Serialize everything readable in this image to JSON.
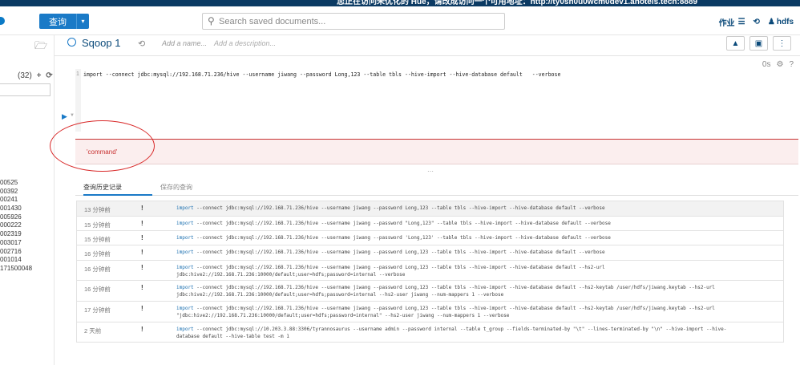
{
  "banner": {
    "text": "您正在访问未优化的 Hue，请改成访问一个可用地址：http://ty0sh0u0wcm0dev1.anotels.tech:8889"
  },
  "toolbar": {
    "query_label": "查询",
    "caret": "▾"
  },
  "search": {
    "placeholder": "Search saved documents..."
  },
  "top_right": {
    "jobs_label": "作业",
    "user_label": "hdfs"
  },
  "sidebar": {
    "count_label": "(32)",
    "items": [
      "00525",
      "00392",
      "00241",
      "001430",
      "005926",
      "000222",
      "002319",
      "003017",
      "002716",
      "001014",
      "171500048"
    ]
  },
  "snippet": {
    "title": "Sqoop 1",
    "name_placeholder": "Add a name...",
    "description_placeholder": "Add a description...",
    "tools_zero": "0s",
    "line_number": "1",
    "code": "import --connect jdbc:mysql://192.168.71.236/hive --username jiwang --password Long,123 --table tbls --hive-import --hive-database default   --verbose",
    "error": "'command'"
  },
  "tabs": {
    "history": "查询历史记录",
    "saved": "保存的查询"
  },
  "history": [
    {
      "time": "13 分钟前",
      "status": "!",
      "kw": "import",
      "cmd": " --connect jdbc:mysql://192.168.71.236/hive --username jiwang --password Long,123 --table tbls --hive-import --hive-database default --verbose",
      "line2": ""
    },
    {
      "time": "15 分钟前",
      "status": "!",
      "kw": "import",
      "cmd": " --connect jdbc:mysql://192.168.71.236/hive --username jiwang --password \"Long,123\" --table tbls --hive-import --hive-database default --verbose",
      "line2": ""
    },
    {
      "time": "15 分钟前",
      "status": "!",
      "kw": "import",
      "cmd": " --connect jdbc:mysql://192.168.71.236/hive --username jiwang --password 'Long,123' --table tbls --hive-import --hive-database default --verbose",
      "line2": ""
    },
    {
      "time": "16 分钟前",
      "status": "!",
      "kw": "import",
      "cmd": " --connect jdbc:mysql://192.168.71.236/hive --username jiwang --password Long,123 --table tbls --hive-import --hive-database default --verbose",
      "line2": ""
    },
    {
      "time": "16 分钟前",
      "status": "!",
      "kw": "import",
      "cmd": " --connect jdbc:mysql://192.168.71.236/hive --username jiwang --password Long,123 --table tbls --hive-import --hive-database default --hs2-url",
      "line2": "jdbc:hive2://192.168.71.236:10000/default;user=hdfs;password=internal --verbose"
    },
    {
      "time": "16 分钟前",
      "status": "!",
      "kw": "import",
      "cmd": " --connect jdbc:mysql://192.168.71.236/hive --username jiwang --password Long,123 --table tbls --hive-import --hive-database default --hs2-keytab /user/hdfs/jiwang.keytab --hs2-url",
      "line2": "jdbc:hive2://192.168.71.236:10000/default;user=hdfs;password=internal --hs2-user jiwang --num-mappers 1 --verbose"
    },
    {
      "time": "17 分钟前",
      "status": "!",
      "kw": "import",
      "cmd": " --connect jdbc:mysql://192.168.71.236/hive --username jiwang --password Long,123 --table tbls --hive-import --hive-database default --hs2-keytab /user/hdfs/jiwang.keytab --hs2-url",
      "line2": "\"jdbc:hive2://192.168.71.236:10000/default;user=hdfs;password=internal\" --hs2-user jiwang --num-mappers 1 --verbose"
    },
    {
      "time": "2 天前",
      "status": "!",
      "kw": "import",
      "cmd": " --connect jdbc:mysql://10.203.3.88:3306/tyrannosaurus --username admin --password internal --table t_group --fields-terminated-by \"\\t\" --lines-terminated-by \"\\n\" --hive-import --hive-",
      "line2": "database default --hive-table test -m 1"
    }
  ],
  "colors": {
    "accent": "#1a7ac7",
    "error": "#c83232",
    "annotation": "#d92b2b"
  }
}
